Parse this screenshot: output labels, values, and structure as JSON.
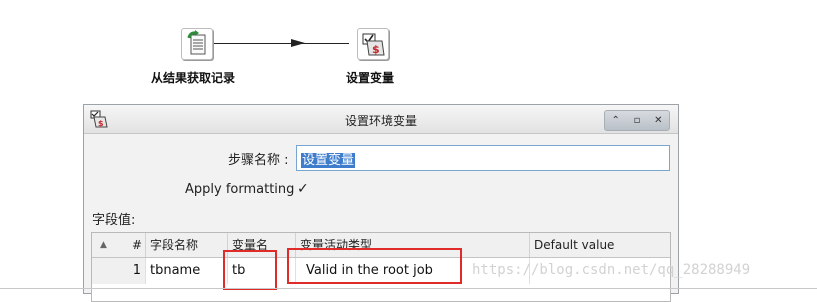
{
  "canvas": {
    "steps": [
      {
        "label": "从结果获取记录",
        "icon": "get-rows-from-result-icon"
      },
      {
        "label": "设置变量",
        "icon": "set-variables-icon"
      }
    ]
  },
  "dialog": {
    "title": "设置环境变量",
    "controls": {
      "restore": "⌃",
      "maximize": "▫",
      "close": "✕"
    },
    "step_name_label": "步骤名称 :",
    "step_name_value": "设置变量",
    "apply_formatting_label": "Apply formatting",
    "apply_formatting_checked": "✓",
    "fields_label": "字段值:",
    "table": {
      "sort_icon": "▲",
      "headers": [
        "#",
        "字段名称",
        "变量名",
        "变量活动类型",
        "Default value"
      ],
      "rows": [
        {
          "num": "1",
          "field_name": "tbname",
          "var_name": "tb",
          "scope": "Valid in the root job",
          "default": ""
        }
      ]
    }
  },
  "watermark": "https://blog.csdn.net/qq_28288949",
  "colors": {
    "highlight_red": "#e02b2b",
    "selection_blue": "#3d7dcc"
  }
}
